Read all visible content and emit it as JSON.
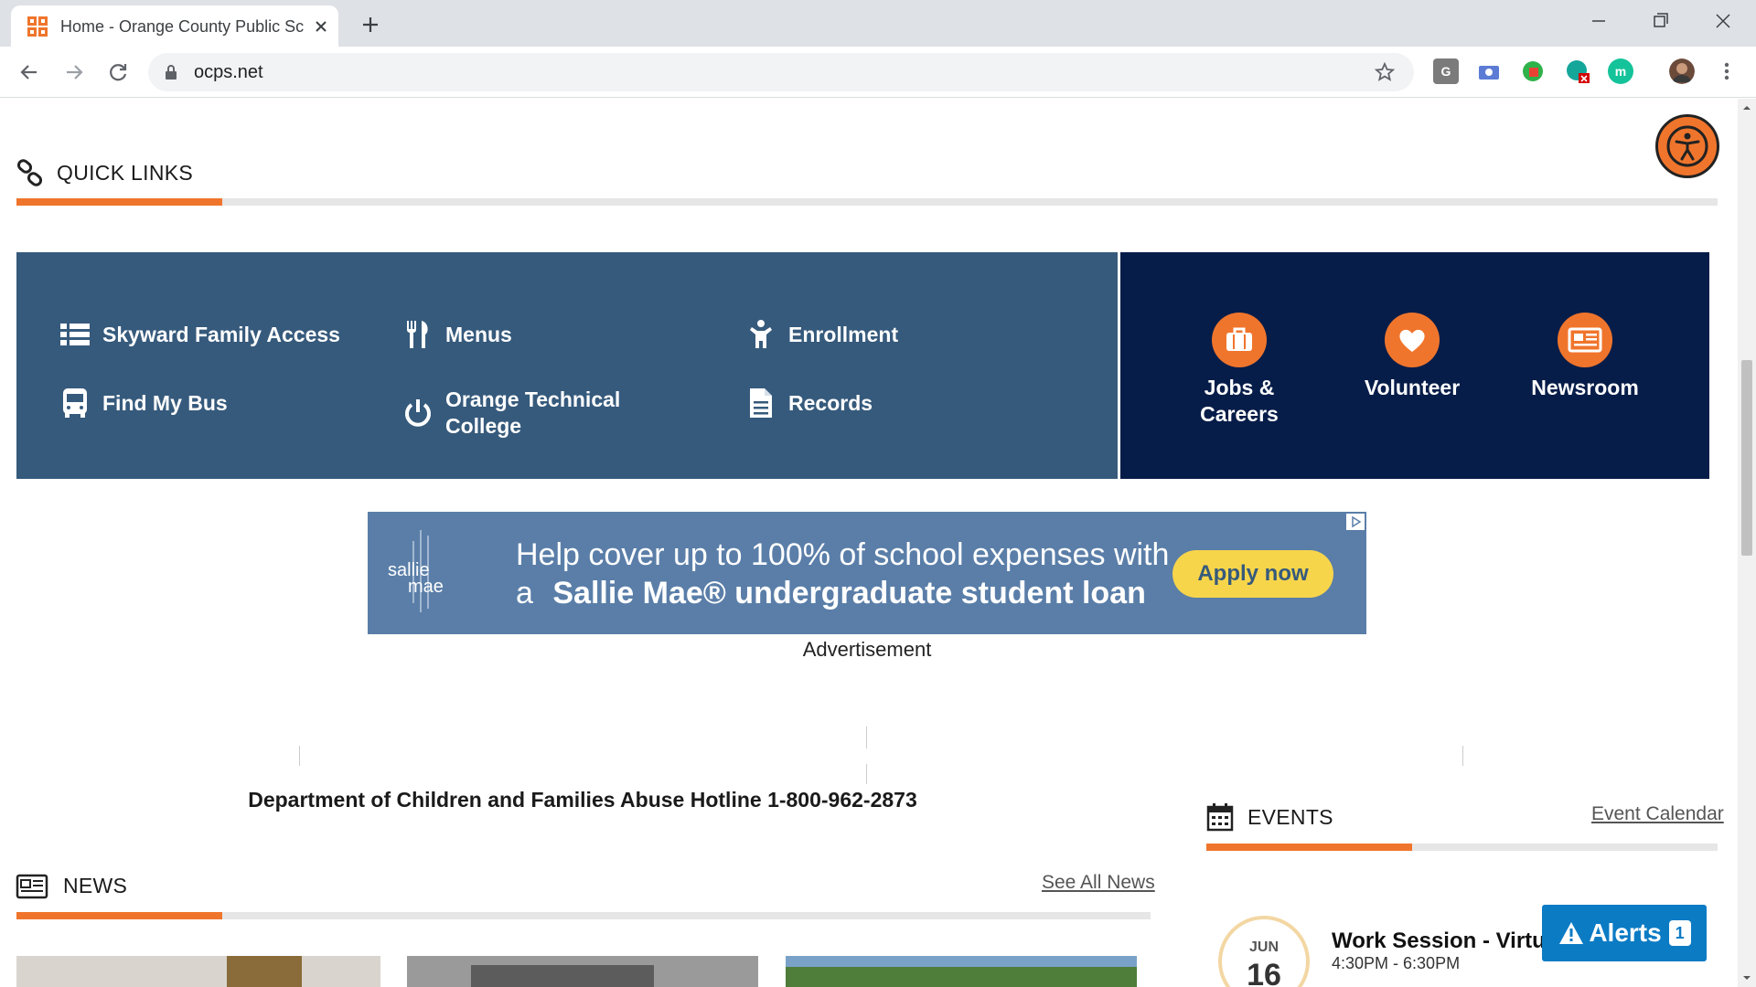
{
  "browser": {
    "tab_title": "Home - Orange County Public Sc",
    "url": "ocps.net",
    "extensions": [
      "G",
      "m"
    ]
  },
  "quick_links": {
    "title": "QUICK LINKS",
    "items": [
      {
        "label": "Skyward Family Access",
        "icon": "list-icon"
      },
      {
        "label": "Menus",
        "icon": "fork-knife-icon"
      },
      {
        "label": "Enrollment",
        "icon": "child-icon"
      },
      {
        "label": "Find My Bus",
        "icon": "bus-icon"
      },
      {
        "label": "Orange Technical College",
        "icon": "power-icon"
      },
      {
        "label": "Records",
        "icon": "document-icon"
      }
    ],
    "featured": [
      {
        "label": "Jobs & Careers",
        "icon": "briefcase-icon"
      },
      {
        "label": "Volunteer",
        "icon": "heart-icon"
      },
      {
        "label": "Newsroom",
        "icon": "newspaper-icon"
      }
    ]
  },
  "ad": {
    "brand_line1": "sallie",
    "brand_line2": "mae",
    "headline1": "Help cover up to 100% of school expenses with",
    "headline2_prefix": "a",
    "headline2_bold": "Sallie Mae® undergraduate student loan",
    "button": "Apply now",
    "caption": "Advertisement"
  },
  "hotline": "Department of Children and Families Abuse Hotline 1-800-962-2873",
  "news": {
    "title": "NEWS",
    "see_all": "See All News"
  },
  "events": {
    "title": "EVENTS",
    "calendar_link": "Event Calendar",
    "items": [
      {
        "month": "JUN",
        "day": "16",
        "title": "Work Session - Virtua",
        "time": "4:30PM - 6:30PM"
      }
    ]
  },
  "alerts": {
    "label": "Alerts",
    "count": "1"
  },
  "colors": {
    "accent": "#f0752c",
    "quicklinks_bg": "#365a7c",
    "featured_bg": "#071d49",
    "alerts_bg": "#0b7bc4"
  }
}
